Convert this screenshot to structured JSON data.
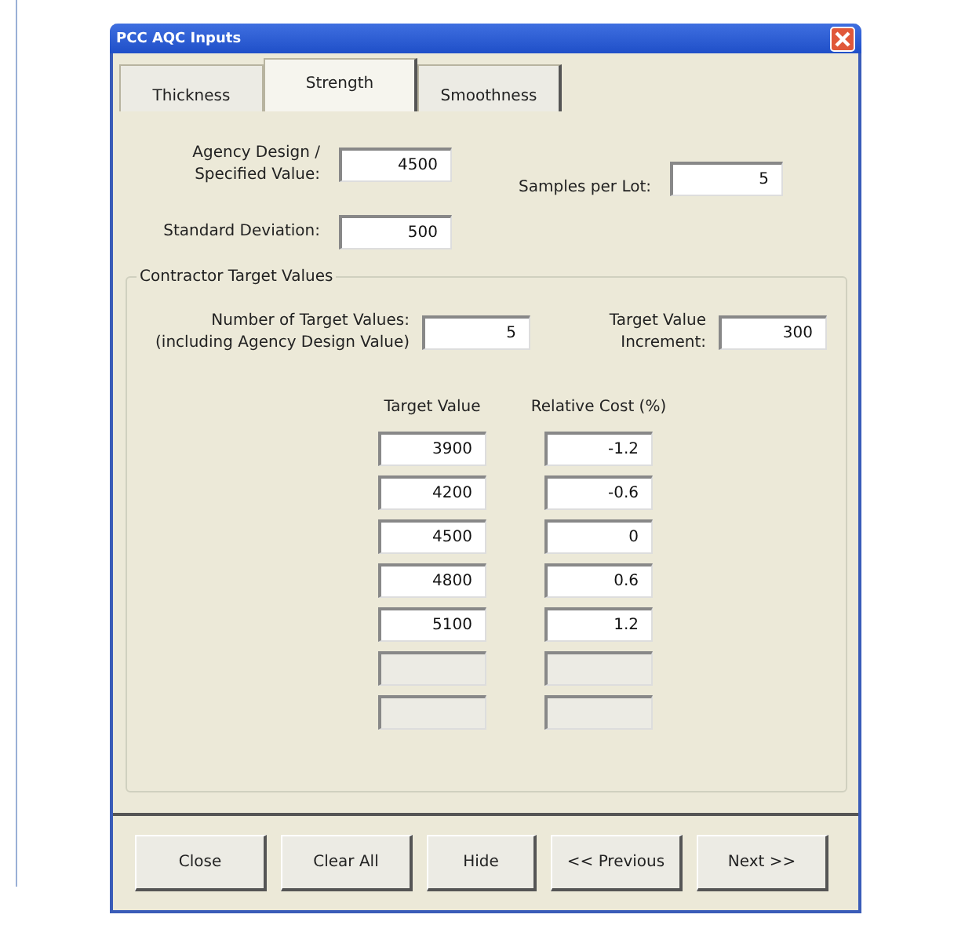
{
  "window": {
    "title": "PCC AQC Inputs"
  },
  "tabs": [
    {
      "label": "Thickness",
      "selected": false
    },
    {
      "label": "Strength",
      "selected": true
    },
    {
      "label": "Smoothness",
      "selected": false
    }
  ],
  "agency_design": {
    "label": "Agency Design / Specified Value:",
    "value": "4500"
  },
  "samples_per_lot": {
    "label": "Samples per Lot:",
    "value": "5"
  },
  "standard_deviation": {
    "label": "Standard Deviation:",
    "value": "500"
  },
  "contractor_target_values": {
    "title": "Contractor Target Values",
    "number_of_target_values": {
      "label": "Number of Target Values:",
      "sublabel": "(including Agency Design Value)",
      "value": "5"
    },
    "target_value_increment": {
      "label": "Target Value",
      "sublabel": "Increment:",
      "value": "300"
    },
    "columns": [
      "Target Value",
      "Relative Cost (%)"
    ],
    "rows": [
      {
        "target_value": "3900",
        "relative_cost": "-1.2",
        "disabled": false
      },
      {
        "target_value": "4200",
        "relative_cost": "-0.6",
        "disabled": false
      },
      {
        "target_value": "4500",
        "relative_cost": "0",
        "disabled": false
      },
      {
        "target_value": "4800",
        "relative_cost": "0.6",
        "disabled": false
      },
      {
        "target_value": "5100",
        "relative_cost": "1.2",
        "disabled": false
      },
      {
        "disabled": true
      },
      {
        "disabled": true
      }
    ]
  },
  "buttons": [
    "Close",
    "Clear All",
    "Hide",
    "<< Previous",
    "Next >>"
  ]
}
